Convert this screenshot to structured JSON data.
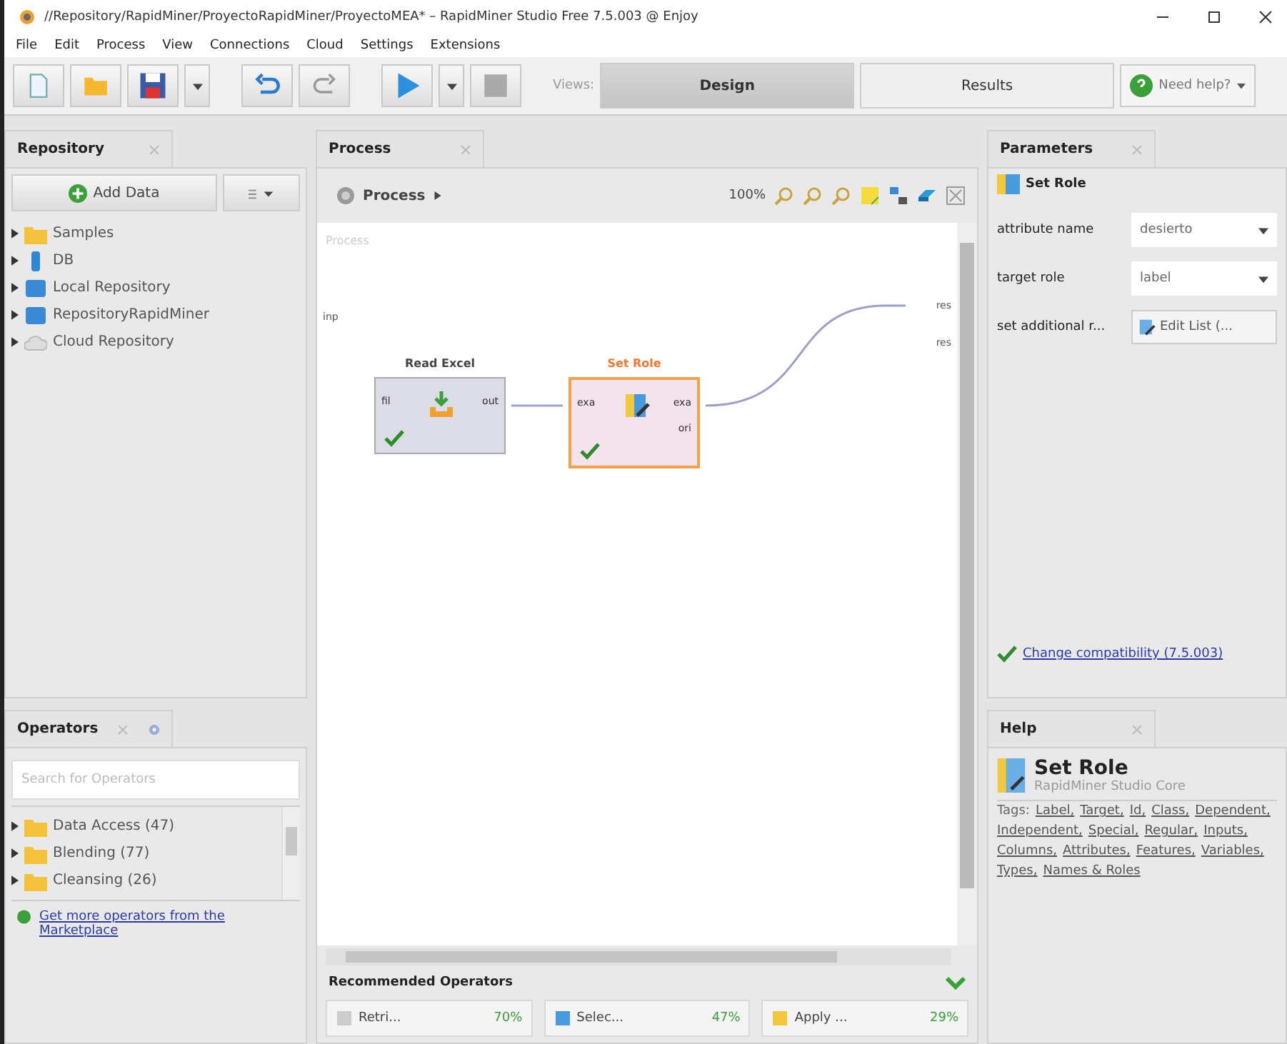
{
  "window": {
    "title": "//Repository/RapidMiner/ProyectoRapidMiner/ProyectoMEA* – RapidMiner Studio Free 7.5.003 @ Enjoy"
  },
  "menu": [
    "File",
    "Edit",
    "Process",
    "View",
    "Connections",
    "Cloud",
    "Settings",
    "Extensions"
  ],
  "toolbar": {
    "views_label": "Views:",
    "views": [
      {
        "label": "Design",
        "selected": true
      },
      {
        "label": "Results",
        "selected": false
      }
    ],
    "help": "Need help?"
  },
  "repository": {
    "tab": "Repository",
    "add_data": "Add Data",
    "items": [
      {
        "label": "Samples",
        "kind": "folder"
      },
      {
        "label": "DB",
        "kind": "db"
      },
      {
        "label": "Local Repository",
        "kind": "repo"
      },
      {
        "label": "RepositoryRapidMiner",
        "kind": "repo"
      },
      {
        "label": "Cloud Repository",
        "kind": "cloud"
      }
    ]
  },
  "operators": {
    "tab": "Operators",
    "search": {
      "placeholder": "Search for Operators"
    },
    "items": [
      {
        "label": "Data Access (47)"
      },
      {
        "label": "Blending (77)"
      },
      {
        "label": "Cleansing (26)"
      }
    ],
    "marketplace_link": "Get more operators from the Marketplace"
  },
  "process": {
    "tab": "Process",
    "breadcrumb": "Process",
    "zoom": "100%",
    "canvas_label": "Process",
    "input_port": "inp",
    "output_ports": [
      "res",
      "res"
    ],
    "operators": [
      {
        "name": "Read Excel",
        "selected": false,
        "in_ports": [
          "fil"
        ],
        "out_ports": [
          "out"
        ]
      },
      {
        "name": "Set Role",
        "selected": true,
        "in_ports": [
          "exa"
        ],
        "out_ports": [
          "exa",
          "ori"
        ]
      }
    ]
  },
  "recommended": {
    "title": "Recommended Operators",
    "items": [
      {
        "label": "Retri...",
        "score": "70%"
      },
      {
        "label": "Selec...",
        "score": "47%"
      },
      {
        "label": "Apply ...",
        "score": "29%"
      }
    ]
  },
  "parameters": {
    "tab": "Parameters",
    "operator": "Set Role",
    "rows": [
      {
        "label": "attribute name",
        "kind": "dropdown",
        "value": "desierto"
      },
      {
        "label": "target role",
        "kind": "dropdown",
        "value": "label"
      },
      {
        "label": "set additional r...",
        "kind": "list",
        "value": "Edit List (..."
      }
    ],
    "compatibility_link": "Change compatibility (7.5.003)"
  },
  "help": {
    "tab": "Help",
    "title": "Set Role",
    "subtitle": "RapidMiner Studio Core",
    "tags_label": "Tags:",
    "tags": [
      "Label,",
      "Target,",
      "Id,",
      "Class,",
      "Dependent,",
      "Independent,",
      "Special,",
      "Regular,",
      "Inputs,",
      "Columns,",
      "Attributes,",
      "Features,",
      "Variables,",
      "Types,",
      "Names & Roles"
    ]
  }
}
